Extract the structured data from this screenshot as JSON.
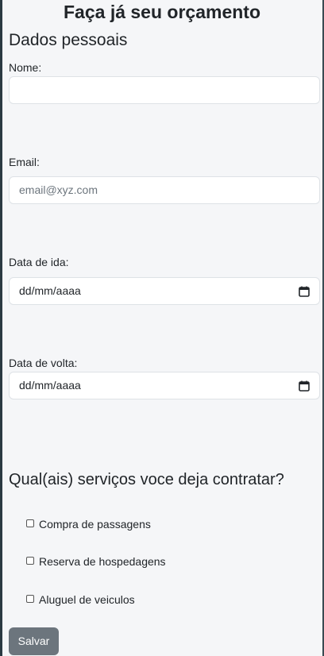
{
  "page": {
    "title": "Faça já seu orçamento",
    "section_title": "Dados pessoais"
  },
  "form": {
    "name_label": "Nome:",
    "name_value": "",
    "email_label": "Email:",
    "email_placeholder": "email@xyz.com",
    "departure_label": "Data de ida:",
    "departure_placeholder": "dd/mm/aaaa",
    "return_label": "Data de volta:",
    "return_placeholder": "dd/mm/aaaa"
  },
  "services": {
    "title": "Qual(ais) serviços voce deja contratar?",
    "options": [
      {
        "label": "Compra de passagens",
        "checked": false
      },
      {
        "label": "Reserva de hospedagens",
        "checked": false
      },
      {
        "label": "Aluguel de veiculos",
        "checked": false
      }
    ]
  },
  "actions": {
    "save_label": "Salvar"
  },
  "icons": {
    "date_picker": "calendar-icon"
  },
  "colors": {
    "button": "#6c757d",
    "border": "#dee2e6",
    "background": "#f5f6f8"
  }
}
